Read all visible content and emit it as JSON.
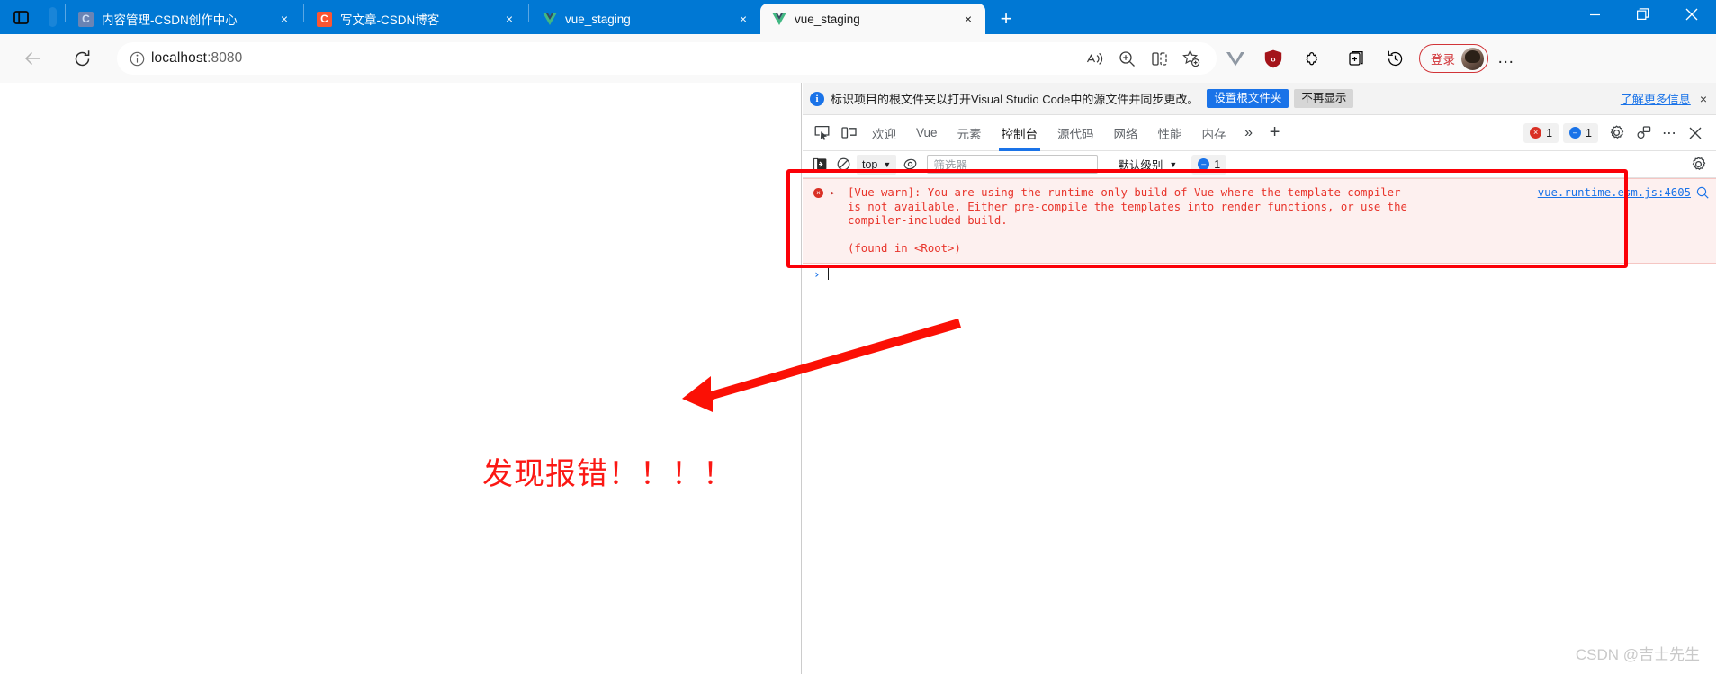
{
  "browser": {
    "window_controls": {
      "minimize": "minimize-icon",
      "maximize": "maximize-icon",
      "close": "close-icon"
    },
    "tabs": [
      {
        "title": "内容管理-CSDN创作中心",
        "favicon": "csdn-blue-icon",
        "favicon_letter": "C",
        "active": false,
        "close": "×"
      },
      {
        "title": "写文章-CSDN博客",
        "favicon": "csdn-red-icon",
        "favicon_letter": "C",
        "active": false,
        "close": "×"
      },
      {
        "title": "vue_staging",
        "favicon": "vue-icon",
        "favicon_letter": "",
        "active": false,
        "close": "×"
      },
      {
        "title": "vue_staging",
        "favicon": "vue-icon",
        "favicon_letter": "",
        "active": true,
        "close": "×"
      }
    ],
    "new_tab_label": "+",
    "toolbar": {
      "back": "back-arrow-icon",
      "reload": "reload-icon",
      "info": "info-circle-icon",
      "url": "localhost",
      "url_port": ":8080",
      "url_full": "localhost:8080",
      "read_aloud": "read-aloud-icon",
      "zoom": "zoom-icon",
      "split_screen": "split-screen-icon",
      "favorite": "add-favorite-icon",
      "ext_vue": "vue-devtools-extension-icon",
      "ext_ublock": "ublock-origin-icon",
      "ext_generic": "extensions-puzzle-icon",
      "collections": "collections-icon",
      "history": "history-icon",
      "signin_label": "登录",
      "settings_dots": "…"
    }
  },
  "devtools": {
    "notice": {
      "icon": "info-icon",
      "text": "标识项目的根文件夹以打开Visual Studio Code中的源文件并同步更改。",
      "primary_button": "设置根文件夹",
      "secondary_button": "不再显示",
      "learn_more": "了解更多信息",
      "close": "×"
    },
    "tabbar": {
      "inspect_icon": "inspect-element-icon",
      "device_icon": "device-toolbar-icon",
      "tabs": [
        {
          "label": "欢迎",
          "selected": false
        },
        {
          "label": "Vue",
          "selected": false
        },
        {
          "label": "元素",
          "selected": false
        },
        {
          "label": "控制台",
          "selected": true
        },
        {
          "label": "源代码",
          "selected": false
        },
        {
          "label": "网络",
          "selected": false
        },
        {
          "label": "性能",
          "selected": false
        },
        {
          "label": "内存",
          "selected": false
        }
      ],
      "overflow": "»",
      "add_panel": "+",
      "error_count": "1",
      "message_count": "1",
      "settings_icon": "gear-icon",
      "customize_icon": "devtools-customize-icon",
      "more_icon": "⋯",
      "close_icon": "×"
    },
    "consolebar": {
      "sidebar_icon": "console-sidebar-icon",
      "clear_icon": "clear-console-icon",
      "context": "top",
      "context_caret": "▼",
      "eye_icon": "live-expression-icon",
      "filter_placeholder": "筛选器",
      "filter_value": "",
      "level": "默认级别",
      "level_caret": "▼",
      "issues_count": "1",
      "settings_icon": "gear-icon"
    },
    "console": {
      "error_icon": "error-circle-icon",
      "expand_triangle": "▸",
      "message": "[Vue warn]: You are using the runtime-only build of Vue where the template compiler is not available. Either pre-compile the templates into render functions, or use the compiler-included build.",
      "message_line1": "[Vue warn]: You are using the runtime-only build of Vue where the template compiler",
      "message_line2": "is not available. Either pre-compile the templates into render functions, or use the",
      "message_line3": "compiler-included build.",
      "message_line4": "(found in <Root>)",
      "source_link": "vue.runtime.esm.js:4605",
      "magnify_icon": "search-in-source-icon",
      "prompt_chevron": "›",
      "prompt_value": ""
    }
  },
  "annotations": {
    "highlight_box": "red-rectangle-highlight",
    "arrow": "red-arrow-icon",
    "text": "发现报错！！！！",
    "text_color": "#fb1814"
  },
  "watermark": "CSDN @吉士先生"
}
